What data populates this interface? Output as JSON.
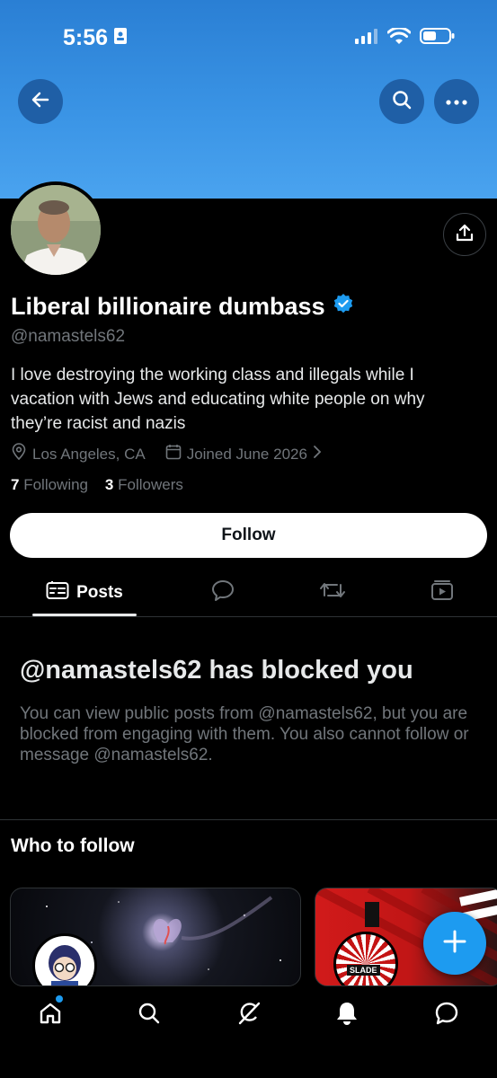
{
  "status_bar": {
    "time": "5:56"
  },
  "profile": {
    "display_name": "Liberal billionaire dumbass",
    "handle": "@namastels62",
    "bio": "I love destroying the working class and illegals while I vacation with Jews and educating white people on why they’re racist and nazis",
    "location": "Los Angeles, CA",
    "joined": "Joined June 2026",
    "following_count": "7",
    "following_label": "Following",
    "followers_count": "3",
    "followers_label": "Followers",
    "follow_button": "Follow"
  },
  "tabs": {
    "posts_label": "Posts"
  },
  "blocked": {
    "title": "@namastels62 has blocked you",
    "description": "You can view public posts from @namastels62, but you are blocked from engaging with them. You also cannot follow or message @namastels62."
  },
  "who_to_follow": {
    "heading": "Who to follow",
    "card2_text": "SLADE"
  },
  "colors": {
    "accent": "#1d9bf0",
    "background": "#000000",
    "verified": "#1d9bf0"
  },
  "icons": [
    "back-arrow-icon",
    "search-icon",
    "more-icon",
    "share-icon",
    "verified-icon",
    "location-icon",
    "calendar-icon",
    "chevron-right-icon",
    "posts-icon",
    "replies-icon",
    "reposts-icon",
    "media-icon",
    "plus-icon",
    "home-icon",
    "grok-icon",
    "bell-icon",
    "messages-icon"
  ]
}
